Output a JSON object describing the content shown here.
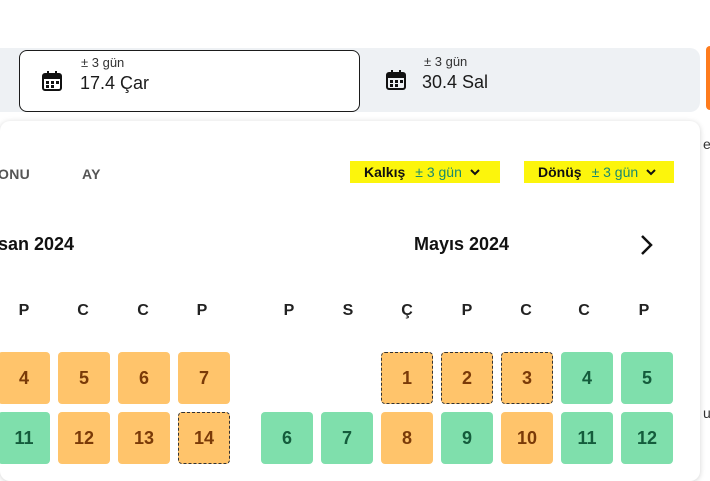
{
  "search": {
    "departure": {
      "flex": "± 3 gün",
      "date": "17.4 Çar"
    },
    "return": {
      "flex": "± 3 gün",
      "date": "30.4 Sal"
    },
    "edge_text": "ek",
    "edge_text2": "u"
  },
  "calendar": {
    "tabs": [
      "ONU",
      "AY"
    ],
    "departure_flex": {
      "label": "Kalkış",
      "value": "± 3 gün"
    },
    "return_flex": {
      "label": "Dönüş",
      "value": "± 3 gün"
    },
    "months": [
      {
        "title": "san 2024",
        "weekdays": [
          "P",
          "C",
          "C",
          "P"
        ]
      },
      {
        "title": "Mayıs 2024",
        "weekdays": [
          "P",
          "S",
          "Ç",
          "P",
          "C",
          "C",
          "P"
        ]
      }
    ],
    "april_rows": [
      [
        "4",
        "5",
        "6",
        "7"
      ],
      [
        "11",
        "12",
        "13",
        "14"
      ]
    ],
    "may_rows": [
      [
        "1",
        "2",
        "3",
        "4",
        "5"
      ],
      [
        "6",
        "7",
        "8",
        "9",
        "10",
        "11",
        "12"
      ]
    ],
    "colors": {
      "cheap": "#7fdfac",
      "mid": "#ffc46b",
      "highlight": "#fcf50c",
      "accent": "#ff7b1c"
    }
  }
}
